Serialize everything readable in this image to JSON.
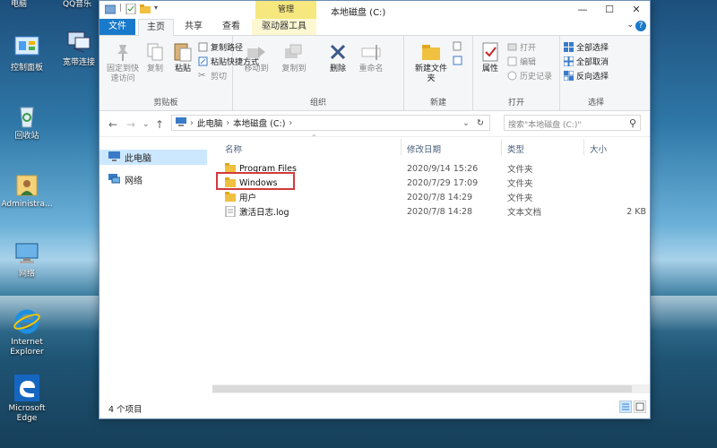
{
  "desktop": {
    "top_labels": [
      "电脑",
      "QQ音乐"
    ],
    "icons": [
      {
        "label": "控制面板"
      },
      {
        "label": "宽带连接"
      },
      {
        "label": "回收站"
      },
      {
        "label": "Administra..."
      },
      {
        "label": "网络"
      },
      {
        "label": "Internet Explorer"
      },
      {
        "label": "Microsoft Edge"
      }
    ]
  },
  "window": {
    "context_tab": "管理",
    "title": "本地磁盘 (C:)",
    "controls": {
      "minimize": "—",
      "maximize": "☐",
      "close": "✕"
    },
    "ribbon_tabs": {
      "file": "文件",
      "home": "主页",
      "share": "共享",
      "view": "查看",
      "drive_tools": "驱动器工具"
    },
    "ribbon": {
      "clipboard": {
        "label": "剪贴板",
        "pin": "固定到快速访问",
        "copy": "复制",
        "paste": "粘贴",
        "copy_path": "复制路径",
        "paste_shortcut": "粘贴快捷方式",
        "cut": "剪切"
      },
      "organize": {
        "label": "组织",
        "move_to": "移动到",
        "copy_to": "复制到",
        "delete": "删除",
        "rename": "重命名"
      },
      "new": {
        "label": "新建",
        "new_folder": "新建文件夹"
      },
      "open": {
        "label": "打开",
        "properties": "属性",
        "open": "打开",
        "edit": "编辑",
        "history": "历史记录"
      },
      "select": {
        "label": "选择",
        "select_all": "全部选择",
        "select_none": "全部取消",
        "invert": "反向选择"
      }
    },
    "address": {
      "path": [
        "此电脑",
        "本地磁盘 (C:)"
      ],
      "search_placeholder": "搜索\"本地磁盘 (C:)\""
    },
    "nav_pane": [
      {
        "label": "此电脑",
        "selected": true
      },
      {
        "label": "网络",
        "selected": false
      }
    ],
    "columns": {
      "name": "名称",
      "date": "修改日期",
      "type": "类型",
      "size": "大小"
    },
    "files": [
      {
        "name": "Program Files",
        "date": "2020/9/14 15:26",
        "type": "文件夹",
        "size": "",
        "kind": "folder"
      },
      {
        "name": "Windows",
        "date": "2020/7/29 17:09",
        "type": "文件夹",
        "size": "",
        "kind": "folder"
      },
      {
        "name": "用户",
        "date": "2020/7/8 14:29",
        "type": "文件夹",
        "size": "",
        "kind": "folder"
      },
      {
        "name": "激活日志.log",
        "date": "2020/7/8 14:28",
        "type": "文本文档",
        "size": "2 KB",
        "kind": "file"
      }
    ],
    "status": {
      "item_count": "4 个项目"
    }
  },
  "colors": {
    "accent": "#1979ca",
    "folder": "#f0c040",
    "selection": "#cce8ff",
    "highlight_box": "#d23a3a"
  }
}
